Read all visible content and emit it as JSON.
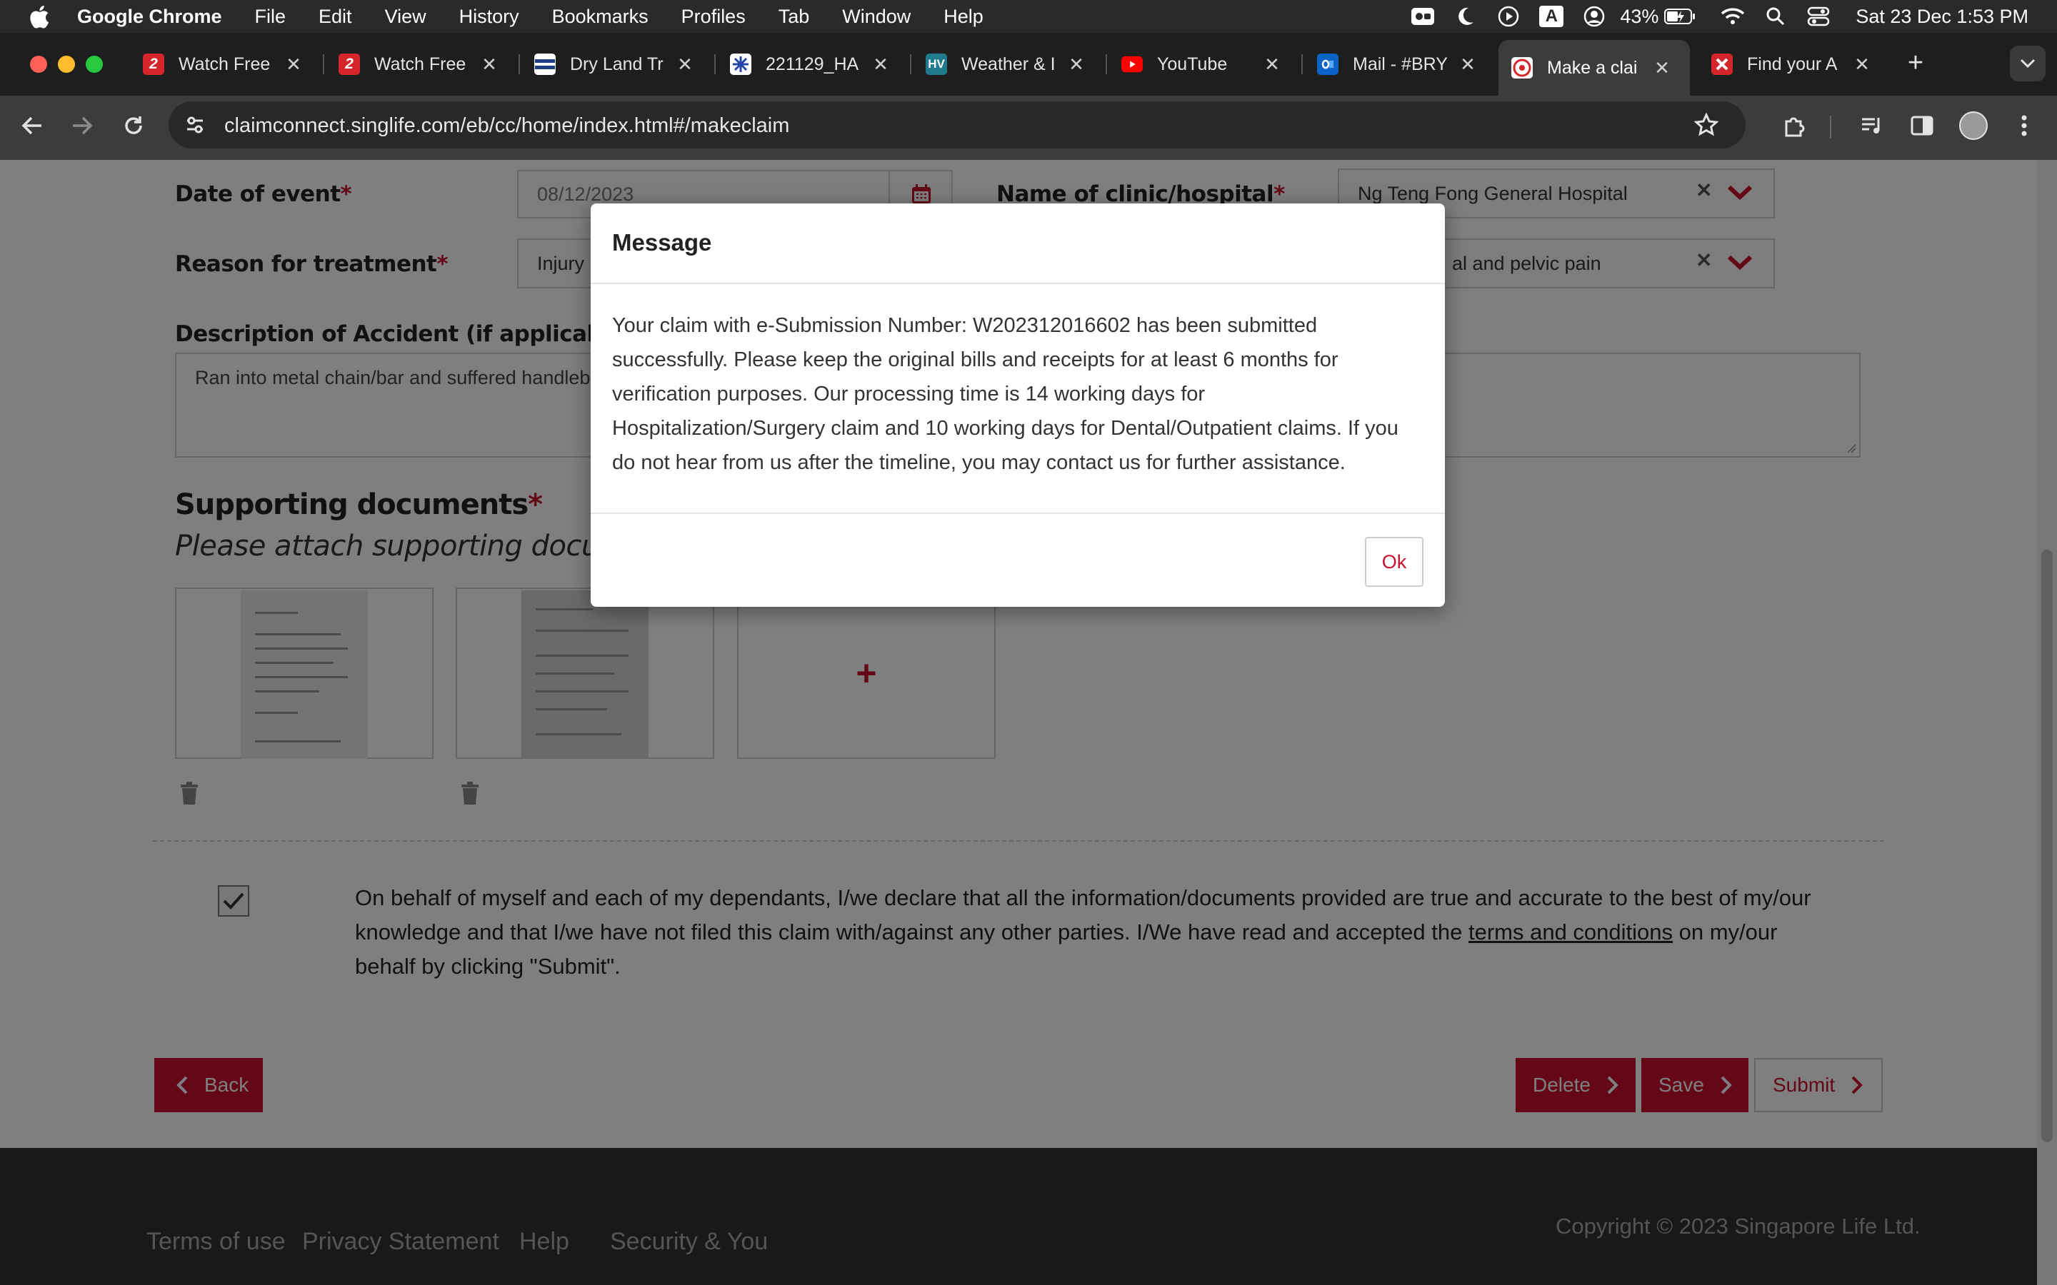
{
  "menubar": {
    "app": "Google Chrome",
    "items": [
      "File",
      "Edit",
      "View",
      "History",
      "Bookmarks",
      "Profiles",
      "Tab",
      "Window",
      "Help"
    ],
    "battery": "43%",
    "datetime": "Sat 23 Dec  1:53 PM",
    "input_badge": "A"
  },
  "tabs": [
    {
      "title": "Watch Free",
      "favicon": "2",
      "favicon_color": "#d4252a"
    },
    {
      "title": "Watch Free",
      "favicon": "2",
      "favicon_color": "#d4252a"
    },
    {
      "title": "Dry Land Tr",
      "favicon": "",
      "favicon_color": "#2b4a8a"
    },
    {
      "title": "221129_HA",
      "favicon": "",
      "favicon_color": "#ffffff"
    },
    {
      "title": "Weather & I",
      "favicon": "HV",
      "favicon_color": "#1f7a8c"
    },
    {
      "title": "YouTube",
      "favicon": "",
      "favicon_color": "#ff0000"
    },
    {
      "title": "Mail - #BRY",
      "favicon": "",
      "favicon_color": "#0a64c8"
    },
    {
      "title": "Make a clai",
      "favicon": "",
      "favicon_color": "#ffffff"
    },
    {
      "title": "Find your A",
      "favicon": "",
      "favicon_color": "#d4252a"
    }
  ],
  "address_bar": {
    "url": "claimconnect.singlife.com/eb/cc/home/index.html#/makeclaim"
  },
  "form": {
    "date_label": "Date of event",
    "date_value": "08/12/2023",
    "clinic_label": "Name of clinic/hospital",
    "clinic_value": "Ng Teng Fong General Hospital",
    "reason_label": "Reason for treatment",
    "reason_value": "Injury",
    "reason2_value": "al and pelvic pain",
    "required_mark": "*",
    "description_label": "Description of Accident (if applicable)",
    "description_value": "Ran into metal chain/bar and suffered handleba",
    "supporting_title": "Supporting documents",
    "supporting_sub": "Please attach supporting documen",
    "add_symbol": "+",
    "declaration_pre": "On behalf of myself and each of my dependants, I/we declare that all the information/documents provided are true and accurate to the best of my/our knowledge and that I/we have not filed this claim with/against any other parties. I/We have read and accepted the ",
    "declaration_link": "terms and conditions",
    "declaration_post": " on my/our behalf by clicking \"Submit\".",
    "back_label": "Back",
    "delete_label": "Delete",
    "save_label": "Save",
    "submit_label": "Submit"
  },
  "footer": {
    "links": [
      "Terms of use",
      "Privacy Statement",
      "Help",
      "Security & You"
    ],
    "copyright": "Copyright © 2023 Singapore Life Ltd."
  },
  "modal": {
    "title": "Message",
    "body": "Your claim with e-Submission Number: W202312016602 has been submitted successfully. Please keep the original bills and receipts for at least 6 months for verification purposes. Our processing time is 14 working days for Hospitalization/Surgery claim and 10 working days for Dental/Outpatient claims. If you do not hear from us after the timeline, you may contact us for further assistance.",
    "ok_label": "Ok"
  },
  "colors": {
    "brand_red": "#c8102e",
    "overlay": "rgba(0,0,0,0.5)"
  }
}
